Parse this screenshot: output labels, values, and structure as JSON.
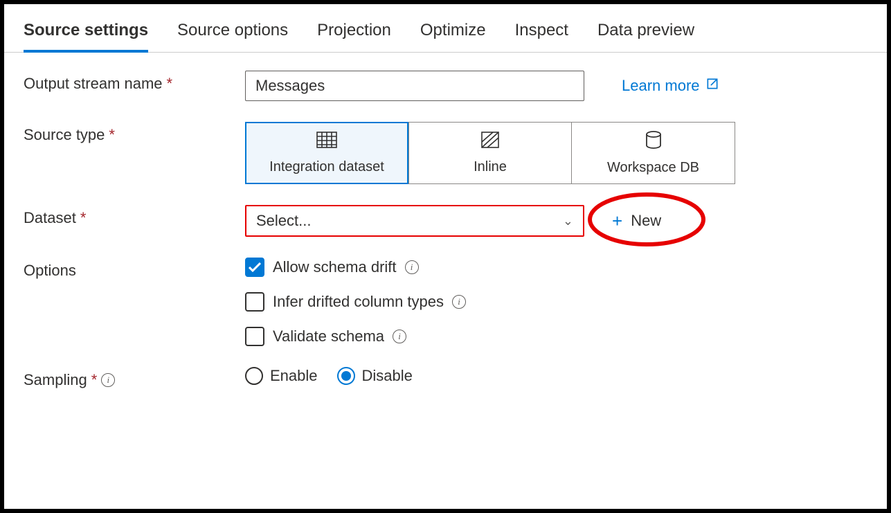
{
  "tabs": [
    "Source settings",
    "Source options",
    "Projection",
    "Optimize",
    "Inspect",
    "Data preview"
  ],
  "activeTab": 0,
  "outputStream": {
    "label": "Output stream name",
    "value": "Messages",
    "learnMore": "Learn more"
  },
  "sourceType": {
    "label": "Source type",
    "options": [
      "Integration dataset",
      "Inline",
      "Workspace DB"
    ],
    "selected": 0
  },
  "dataset": {
    "label": "Dataset",
    "placeholder": "Select...",
    "newLabel": "New"
  },
  "options": {
    "label": "Options",
    "items": [
      {
        "label": "Allow schema drift",
        "checked": true
      },
      {
        "label": "Infer drifted column types",
        "checked": false
      },
      {
        "label": "Validate schema",
        "checked": false
      }
    ]
  },
  "sampling": {
    "label": "Sampling",
    "options": [
      "Enable",
      "Disable"
    ],
    "selected": 1
  }
}
